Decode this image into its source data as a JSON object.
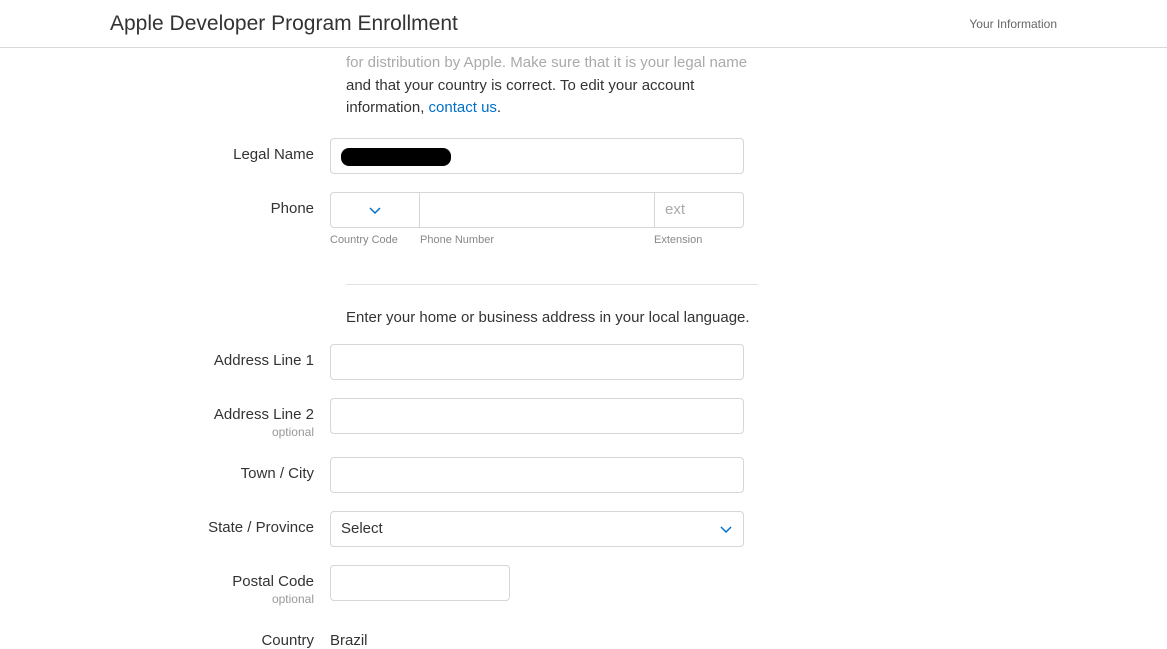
{
  "header": {
    "title": "Apple Developer Program Enrollment",
    "right": "Your Information"
  },
  "intro": {
    "cut_line": "for distribution by Apple. Make sure that it is your legal name",
    "line2a": "and that your country is correct. To edit your account",
    "line3a": "information, ",
    "link": "contact us",
    "line3b": "."
  },
  "labels": {
    "legal_name": "Legal Name",
    "phone": "Phone",
    "addr1": "Address Line 1",
    "addr2": "Address Line 2",
    "town": "Town / City",
    "state": "State / Province",
    "postal": "Postal Code",
    "country": "Country",
    "optional": "optional"
  },
  "phone": {
    "cc_sub": "Country Code",
    "num_sub": "Phone Number",
    "ext_sub": "Extension",
    "ext_placeholder": "ext"
  },
  "address_intro": "Enter your home or business address in your local language.",
  "state_select": {
    "placeholder": "Select"
  },
  "country_value": "Brazil"
}
